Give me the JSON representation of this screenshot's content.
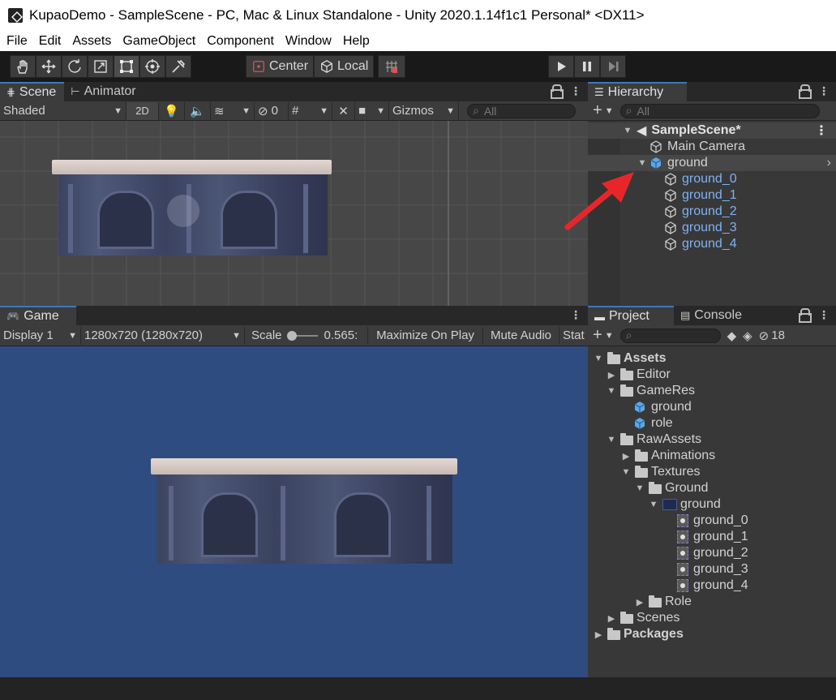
{
  "window": {
    "title": "KupaoDemo - SampleScene - PC, Mac & Linux Standalone - Unity 2020.1.14f1c1 Personal* <DX11>"
  },
  "menu": {
    "items": [
      "File",
      "Edit",
      "Assets",
      "GameObject",
      "Component",
      "Window",
      "Help"
    ]
  },
  "toolbar": {
    "tools": [
      "hand-tool-icon",
      "move-tool-icon",
      "rotate-tool-icon",
      "scale-tool-icon",
      "rect-tool-icon",
      "transform-tool-icon",
      "custom-tool-icon"
    ],
    "pivot_label": "Center",
    "space_label": "Local"
  },
  "scene": {
    "tab_label": "Scene",
    "animator_tab_label": "Animator",
    "shading_mode": "Shaded",
    "mode_2d": "2D",
    "hidden_count": "0",
    "gizmos_label": "Gizmos",
    "search_placeholder": "All"
  },
  "game": {
    "tab_label": "Game",
    "display": "Display 1",
    "resolution": "1280x720 (1280x720)",
    "scale_label": "Scale",
    "scale_value": "0.565:",
    "maximize_label": "Maximize On Play",
    "mute_label": "Mute Audio",
    "stats_label": "Stat",
    "colors": {
      "background": "#2e4c80"
    }
  },
  "hierarchy": {
    "tab_label": "Hierarchy",
    "search_placeholder": "All",
    "scene_name": "SampleScene*",
    "items": [
      {
        "name": "Main Camera",
        "indent": 1,
        "type": "gameobject"
      },
      {
        "name": "ground",
        "indent": 1,
        "type": "prefab-root",
        "expanded": true
      },
      {
        "name": "ground_0",
        "indent": 2,
        "type": "child"
      },
      {
        "name": "ground_1",
        "indent": 2,
        "type": "child"
      },
      {
        "name": "ground_2",
        "indent": 2,
        "type": "child"
      },
      {
        "name": "ground_3",
        "indent": 2,
        "type": "child"
      },
      {
        "name": "ground_4",
        "indent": 2,
        "type": "child"
      }
    ]
  },
  "project": {
    "tab_label": "Project",
    "console_tab_label": "Console",
    "hidden_count": "18",
    "tree": [
      {
        "name": "Assets",
        "indent": 0,
        "type": "folder",
        "expanded": true,
        "bold": true
      },
      {
        "name": "Editor",
        "indent": 1,
        "type": "folder",
        "expanded": false
      },
      {
        "name": "GameRes",
        "indent": 1,
        "type": "folder",
        "expanded": true
      },
      {
        "name": "ground",
        "indent": 2,
        "type": "prefab"
      },
      {
        "name": "role",
        "indent": 2,
        "type": "prefab"
      },
      {
        "name": "RawAssets",
        "indent": 1,
        "type": "folder",
        "expanded": true
      },
      {
        "name": "Animations",
        "indent": 2,
        "type": "folder",
        "expanded": false
      },
      {
        "name": "Textures",
        "indent": 2,
        "type": "folder",
        "expanded": true
      },
      {
        "name": "Ground",
        "indent": 3,
        "type": "folder",
        "expanded": true
      },
      {
        "name": "ground",
        "indent": 4,
        "type": "texture",
        "expanded": true
      },
      {
        "name": "ground_0",
        "indent": 5,
        "type": "sprite"
      },
      {
        "name": "ground_1",
        "indent": 5,
        "type": "sprite"
      },
      {
        "name": "ground_2",
        "indent": 5,
        "type": "sprite"
      },
      {
        "name": "ground_3",
        "indent": 5,
        "type": "sprite"
      },
      {
        "name": "ground_4",
        "indent": 5,
        "type": "sprite"
      },
      {
        "name": "Role",
        "indent": 3,
        "type": "folder",
        "expanded": false
      },
      {
        "name": "Scenes",
        "indent": 1,
        "type": "folder",
        "expanded": false
      },
      {
        "name": "Packages",
        "indent": 0,
        "type": "folder",
        "expanded": false,
        "bold": true
      }
    ]
  },
  "colors": {
    "accent": "#3a79bb",
    "prefab_text": "#7fb2ef",
    "annotation_arrow": "#e8262a"
  }
}
